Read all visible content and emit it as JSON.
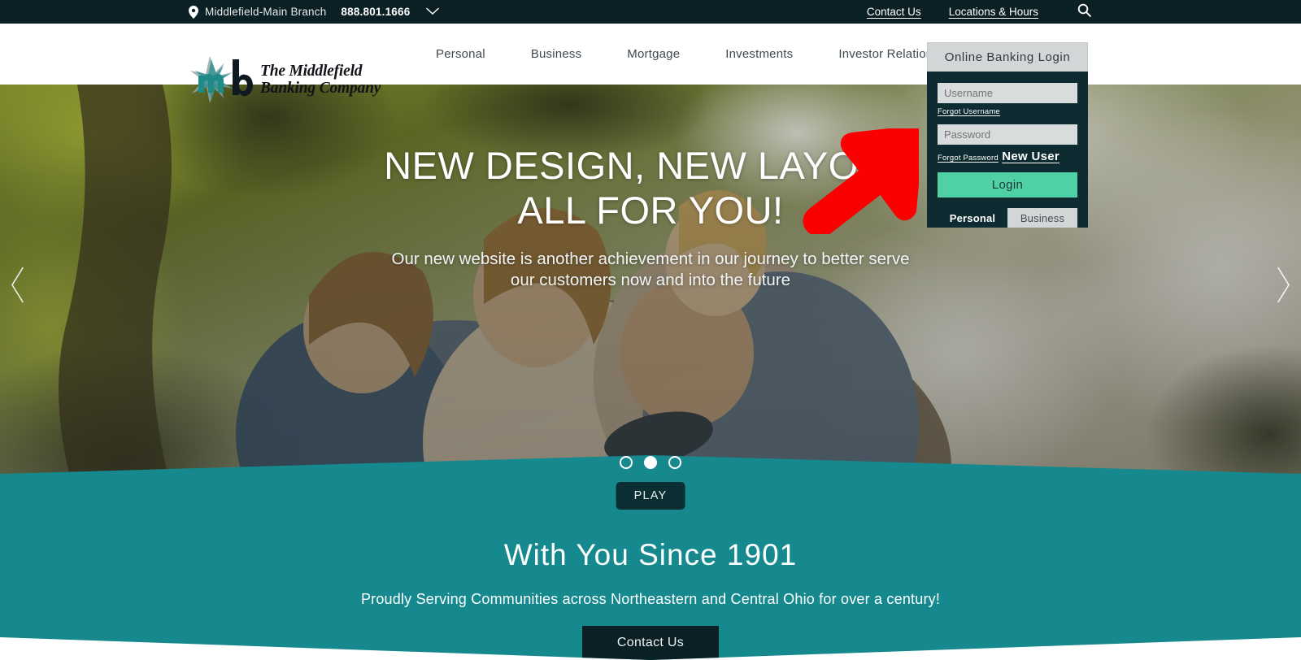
{
  "colors": {
    "topbar_bg": "#0b2025",
    "teal": "#16898e",
    "login_panel": "#0d2b30",
    "login_button": "#4fd1a5",
    "annotation_arrow": "#fa0000",
    "nav_text": "#3c4a52"
  },
  "topbar": {
    "pin_icon": "location-pin-icon",
    "branch": "Middlefield-Main Branch",
    "phone": "888.801.1666",
    "caret_icon": "chevron-down-icon",
    "links": [
      {
        "label": "Contact Us"
      },
      {
        "label": "Locations & Hours"
      }
    ],
    "search_icon": "search-icon"
  },
  "header": {
    "logo": {
      "mark": "mb-starburst-logo-icon",
      "line1": "The Middlefield",
      "line2": "Banking Company"
    },
    "nav": [
      {
        "label": "Personal"
      },
      {
        "label": "Business"
      },
      {
        "label": "Mortgage"
      },
      {
        "label": "Investments"
      },
      {
        "label": "Investor Relations"
      }
    ]
  },
  "login": {
    "heading": "Online Banking Login",
    "username_placeholder": "Username",
    "username_value": "",
    "forgot_username": "Forgot Username",
    "password_placeholder": "Password",
    "password_value": "",
    "forgot_password": "Forgot Password",
    "new_user": "New User",
    "submit_label": "Login",
    "tabs": [
      {
        "label": "Personal",
        "active": true
      },
      {
        "label": "Business",
        "active": false
      }
    ]
  },
  "hero": {
    "title_line1": "NEW DESIGN, NEW LAYOUT,",
    "title_line2": "ALL FOR YOU!",
    "subtitle_line1": "Our new website is another achievement in our journey to better serve",
    "subtitle_line2": "our customers now and into the future",
    "prev_icon": "chevron-left-icon",
    "next_icon": "chevron-right-icon",
    "dots": [
      {
        "active": false
      },
      {
        "active": true
      },
      {
        "active": false
      }
    ],
    "play_label": "PLAY"
  },
  "annotation": {
    "arrow_icon": "red-arrow-pointing-up-right-icon"
  },
  "promo": {
    "title": "With You Since 1901",
    "subtitle": "Proudly Serving Communities across Northeastern and Central Ohio for over a century!",
    "cta_label": "Contact Us"
  }
}
